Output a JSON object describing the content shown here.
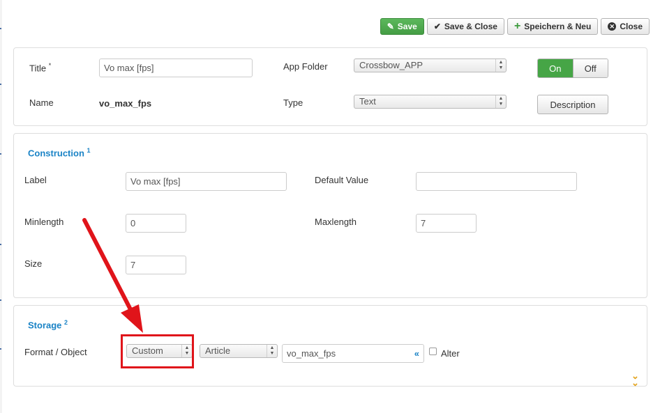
{
  "toolbar": {
    "save": "Save",
    "save_close": "Save & Close",
    "save_new": "Speichern & Neu",
    "close": "Close"
  },
  "general": {
    "title_label": "Title",
    "required_marker": "*",
    "title_value": "Vo max [fps]",
    "name_label": "Name",
    "name_value": "vo_max_fps",
    "app_folder_label": "App Folder",
    "app_folder_value": "Crossbow_APP",
    "type_label": "Type",
    "type_value": "Text",
    "toggle_on": "On",
    "toggle_off": "Off",
    "toggle_state": "On",
    "description_button": "Description"
  },
  "construction": {
    "legend": "Construction",
    "legend_num": "1",
    "label_label": "Label",
    "label_value": "Vo max [fps]",
    "default_label": "Default Value",
    "default_value": "",
    "minlength_label": "Minlength",
    "minlength_value": "0",
    "maxlength_label": "Maxlength",
    "maxlength_value": "7",
    "size_label": "Size",
    "size_value": "7"
  },
  "storage": {
    "legend": "Storage",
    "legend_num": "2",
    "format_label": "Format / Object",
    "format_value": "Custom",
    "object_value": "Article",
    "field_value": "vo_max_fps",
    "field_button": "«",
    "alter_label": "Alter",
    "alter_checked": false
  },
  "annotation": {
    "arrow_color": "#e0141a",
    "box_color": "#e0141a"
  },
  "colors": {
    "save_green": "#5cb85c",
    "toggle_on": "#46a546",
    "legend_blue": "#1a83c6",
    "expand_chevron": "#e3a21a"
  }
}
